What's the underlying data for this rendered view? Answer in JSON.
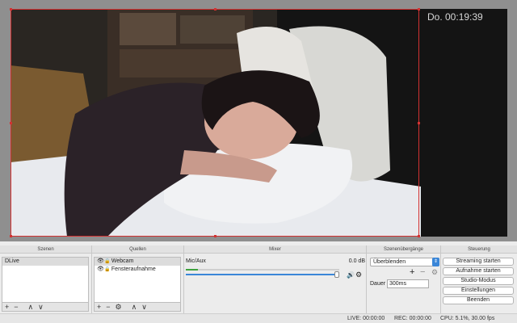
{
  "preview": {
    "clock_text": "Do. 00:19:39"
  },
  "docks": {
    "scenes": {
      "title": "Szenen",
      "items": [
        "DLive"
      ],
      "toolbar": [
        "+",
        "−",
        "∧",
        "∨"
      ]
    },
    "sources": {
      "title": "Quellen",
      "items": [
        {
          "label": "Webcam",
          "visible": true,
          "locked": false
        },
        {
          "label": "Fensteraufnahme",
          "visible": true,
          "locked": false
        }
      ],
      "toolbar": [
        "+",
        "−",
        "⚙",
        "∧",
        "∨"
      ]
    },
    "mixer": {
      "title": "Mixer",
      "channel": {
        "name": "Mic/Aux",
        "level": "0.0 dB",
        "meter_fraction": 0.08,
        "volume_fraction": 1.0
      }
    },
    "transitions": {
      "title": "Szenenübergänge",
      "selected": "Überblenden",
      "duration_label": "Dauer",
      "duration_value": "300ms"
    },
    "controls": {
      "title": "Steuerung",
      "buttons": [
        "Streaming starten",
        "Aufnahme starten",
        "Studio-Modus",
        "Einstellungen",
        "Beenden"
      ]
    }
  },
  "status": {
    "live": "LIVE: 00:00:00",
    "rec": "REC: 00:00:00",
    "cpu": "CPU: 5.1%, 30.00 fps"
  }
}
